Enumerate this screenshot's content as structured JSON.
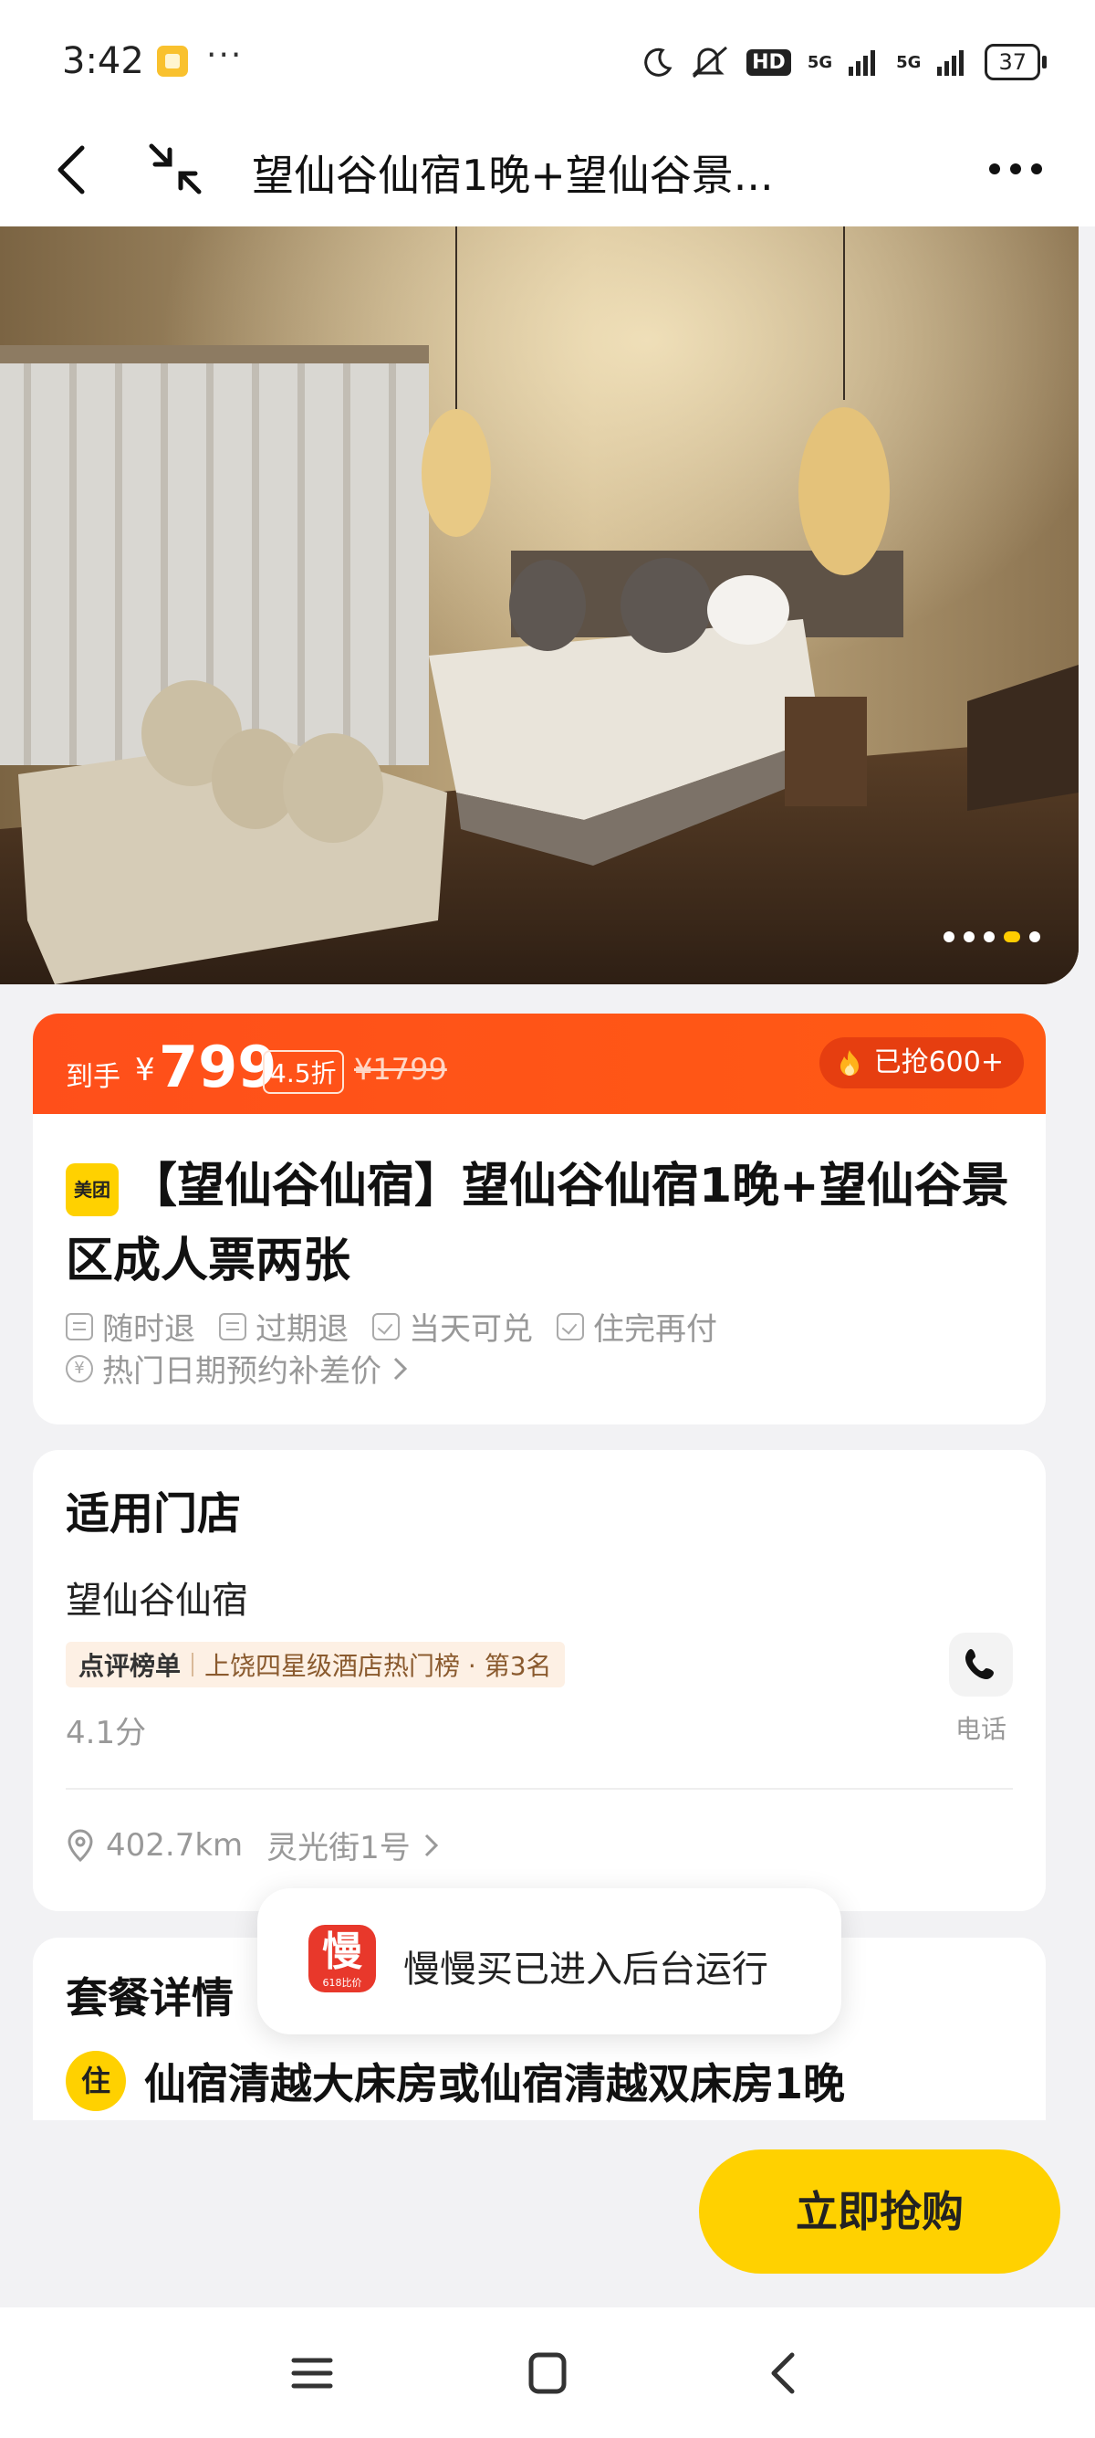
{
  "status_bar": {
    "time": "3:42",
    "more": "···",
    "hd": "HD",
    "signal1": "5G",
    "signal2": "5G",
    "battery": "37"
  },
  "nav": {
    "title": "望仙谷仙宿1晚+望仙谷景..."
  },
  "hero": {
    "page_count": 5,
    "active_page": 4
  },
  "price": {
    "daoshou_label": "到手",
    "currency": "¥",
    "amount": "799",
    "discount": "4.5折",
    "original": "¥1799",
    "sold": "已抢600+"
  },
  "deal": {
    "badge": "美团",
    "title": "【望仙谷仙宿】望仙谷仙宿1晚+望仙谷景区成人票两张",
    "tags": [
      "随时退",
      "过期退",
      "当天可兑",
      "住完再付"
    ],
    "hot_dates": "热门日期预约补差价"
  },
  "store": {
    "header": "适用门店",
    "name": "望仙谷仙宿",
    "rank_brand": "点评榜单",
    "rank_text": "上饶四星级酒店热门榜 · 第3名",
    "score": "4.1分",
    "phone_label": "电话",
    "distance": "402.7km",
    "address": "灵光街1号"
  },
  "package": {
    "header": "套餐详情",
    "icon_label": "住",
    "room": "仙宿清越大床房或仙宿清越双床房1晚"
  },
  "toast": {
    "icon_char": "慢",
    "icon_sub": "618比价",
    "text": "慢慢买已进入后台运行"
  },
  "buy_button": "立即抢购"
}
